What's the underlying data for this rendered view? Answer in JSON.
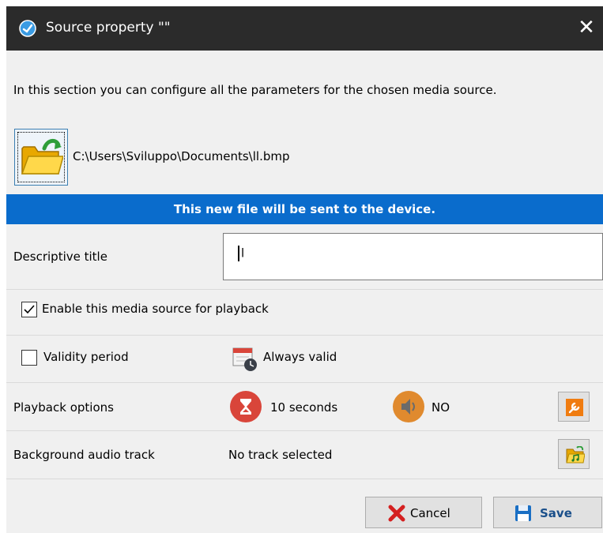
{
  "window": {
    "title": "Source property \"\"",
    "app_icon": "app-logo-icon",
    "close_icon": "close-icon"
  },
  "intro_text": "In this section you can configure all the parameters for the chosen media source.",
  "file": {
    "icon": "open-folder-icon",
    "path": "C:\\Users\\Sviluppo\\Documents\\ll.bmp"
  },
  "banner": {
    "text": "This new file will be sent to the device.",
    "color": "#0a6ccc"
  },
  "descriptive_title": {
    "label": "Descriptive title",
    "value": "l"
  },
  "enable_playback": {
    "label": "Enable this media source for playback",
    "checked": true
  },
  "validity": {
    "label": "Validity period",
    "checked": false,
    "icon": "calendar-clock-icon",
    "value": "Always valid"
  },
  "playback_options": {
    "label": "Playback options",
    "duration_icon": "hourglass-icon",
    "duration": "10 seconds",
    "audio_icon": "speaker-icon",
    "audio": "NO",
    "settings_icon": "wrench-icon"
  },
  "background_audio": {
    "label": "Background audio track",
    "value": "No track selected",
    "select_icon": "music-folder-icon"
  },
  "buttons": {
    "cancel": "Cancel",
    "cancel_icon": "red-x-icon",
    "save": "Save",
    "save_icon": "floppy-disk-icon"
  },
  "colors": {
    "titlebar": "#2b2b2b",
    "accent": "#0a6ccc",
    "hourglass": "#d9453a",
    "speaker": "#e08a2e"
  }
}
